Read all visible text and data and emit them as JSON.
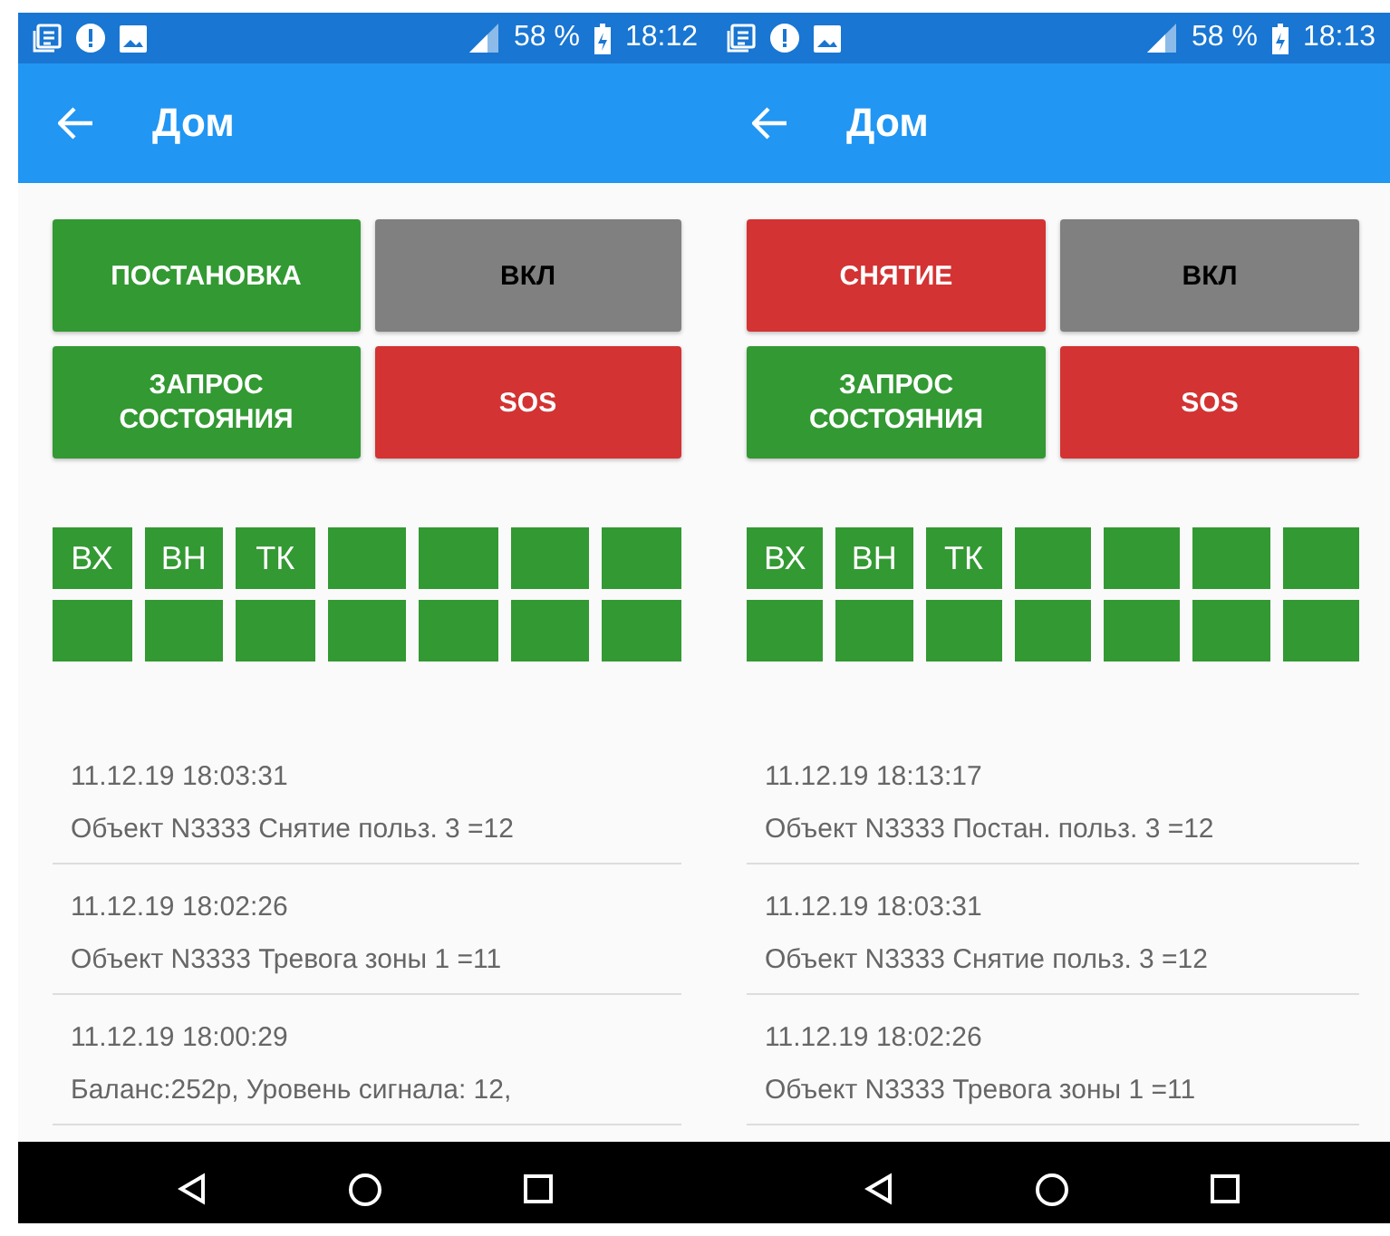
{
  "phones": [
    {
      "status_bar": {
        "battery": "58 %",
        "time": "18:12"
      },
      "title": "Дом",
      "buttons": [
        {
          "label": "ПОСТАНОВКА",
          "color": "#339933"
        },
        {
          "label": "ВКЛ",
          "color": "#808080"
        },
        {
          "label": "ЗАПРОС\nСОСТОЯНИЯ",
          "color": "#339933"
        },
        {
          "label": "SOS",
          "color": "#d33333"
        }
      ],
      "zones": [
        {
          "kind": "labeled",
          "label": "ВХ"
        },
        {
          "kind": "labeled",
          "label": "ВН"
        },
        {
          "kind": "labeled",
          "label": "ТК"
        },
        {
          "kind": "blank"
        },
        {
          "kind": "blank"
        },
        {
          "kind": "blank"
        },
        {
          "kind": "blank"
        },
        {
          "kind": "blank"
        },
        {
          "kind": "blank"
        },
        {
          "kind": "blank"
        },
        {
          "kind": "blank"
        },
        {
          "kind": "blank"
        },
        {
          "kind": "blank"
        },
        {
          "kind": "blank"
        }
      ],
      "events": [
        {
          "time": "11.12.19 18:03:31",
          "text": "Объект N3333 Снятие польз. 3 =12"
        },
        {
          "time": "11.12.19 18:02:26",
          "text": "Объект N3333 Тревога зоны 1 =11"
        },
        {
          "time": "11.12.19 18:00:29",
          "text": "Баланс:252р, Уровень сигнала: 12,"
        }
      ]
    },
    {
      "status_bar": {
        "battery": "58 %",
        "time": "18:13"
      },
      "title": "Дом",
      "buttons": [
        {
          "label": "СНЯТИЕ",
          "color": "#d33333"
        },
        {
          "label": "ВКЛ",
          "color": "#808080"
        },
        {
          "label": "ЗАПРОС\nСОСТОЯНИЯ",
          "color": "#339933"
        },
        {
          "label": "SOS",
          "color": "#d33333"
        }
      ],
      "zones": [
        {
          "kind": "labeled",
          "label": "ВХ"
        },
        {
          "kind": "labeled",
          "label": "ВН"
        },
        {
          "kind": "labeled",
          "label": "ТК"
        },
        {
          "kind": "blank"
        },
        {
          "kind": "blank"
        },
        {
          "kind": "blank"
        },
        {
          "kind": "blank"
        },
        {
          "kind": "blank"
        },
        {
          "kind": "blank"
        },
        {
          "kind": "blank"
        },
        {
          "kind": "blank"
        },
        {
          "kind": "blank"
        },
        {
          "kind": "blank"
        },
        {
          "kind": "blank"
        }
      ],
      "events": [
        {
          "time": "11.12.19 18:13:17",
          "text": "Объект N3333 Постан. польз. 3 =12"
        },
        {
          "time": "11.12.19 18:03:31",
          "text": "Объект N3333 Снятие польз. 3 =12"
        },
        {
          "time": "11.12.19 18:02:26",
          "text": "Объект N3333 Тревога зоны 1 =11"
        }
      ]
    }
  ]
}
